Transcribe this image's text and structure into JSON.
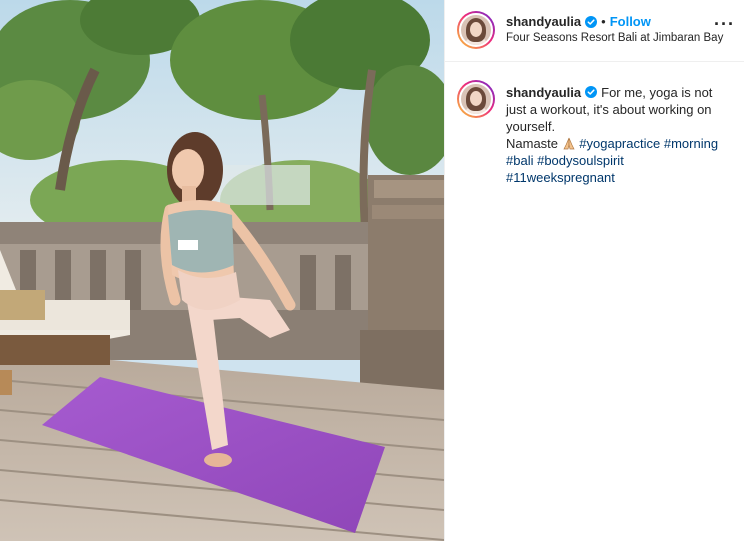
{
  "post": {
    "username": "shandyaulia",
    "follow_label": "Follow",
    "separator": "•",
    "location": "Four Seasons Resort Bali at Jimbaran Bay",
    "more_label": "···",
    "verified_icon": "verified-badge-icon",
    "caption": {
      "username": "shandyaulia",
      "text_1": "For me, yoga is not just a workout, it's about working on yourself.",
      "text_2": "Namaste",
      "emoji": "folded-hands-icon",
      "hashtags": [
        "#yogapractice",
        "#morning",
        "#bali",
        "#bodysoulspirit",
        "#11weekspregnant"
      ]
    }
  },
  "colors": {
    "link_blue": "#0095f6",
    "hashtag": "#00376b",
    "text": "#262626",
    "mat": "#9c4fc4"
  }
}
